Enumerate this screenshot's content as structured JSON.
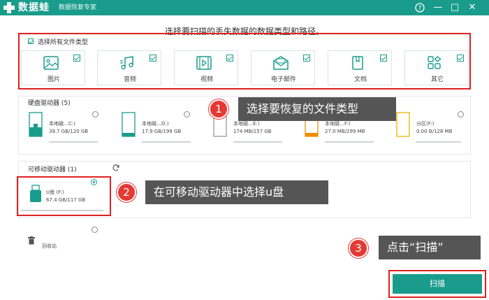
{
  "app": {
    "name": "数据蛙",
    "subtitle": "数据恢复专家",
    "help_icon": "help-circle-icon",
    "min_symbol": "—",
    "max_symbol": "□",
    "close_symbol": "✕"
  },
  "instruction": "选择要扫描的丢失数据的数据类型和路径。",
  "file_types": {
    "select_all_label": "选择所有文件类型",
    "items": [
      {
        "label": "图片",
        "icon": "image-icon"
      },
      {
        "label": "音频",
        "icon": "music-icon"
      },
      {
        "label": "视频",
        "icon": "video-icon"
      },
      {
        "label": "电子邮件",
        "icon": "email-icon"
      },
      {
        "label": "文档",
        "icon": "document-icon"
      },
      {
        "label": "其它",
        "icon": "other-icon"
      }
    ]
  },
  "hard_drives": {
    "title": "硬盘驱动器 (5)",
    "items": [
      {
        "name": "本地磁…C:)",
        "size": "39.7 GB/120 GB"
      },
      {
        "name": "本地磁…D:)",
        "size": "17.9 GB/199 GB"
      },
      {
        "name": "本地磁…E:)",
        "size": "174 MB/157 GB"
      },
      {
        "name": "本地磁…F:)",
        "size": "27.0 MB/299 MB"
      },
      {
        "name": "分区(F:)",
        "size": "0.00  B/128 MB"
      }
    ]
  },
  "removable": {
    "title": "可移动驱动器 (1)",
    "items": [
      {
        "name": "U盘 (F:)",
        "size": "67.4 GB/117 GB"
      }
    ]
  },
  "other": {
    "recycle_bin_label": "回收站"
  },
  "callouts": [
    {
      "number": "1",
      "text": "选择要恢复的文件类型"
    },
    {
      "number": "2",
      "text": "在可移动驱动器中选择u盘"
    },
    {
      "number": "3",
      "text": "点击“扫描”"
    }
  ],
  "scan_button_label": "扫描",
  "colors": {
    "accent": "#1a9c8c",
    "highlight": "#e02020",
    "callout_bg": "#555555"
  }
}
